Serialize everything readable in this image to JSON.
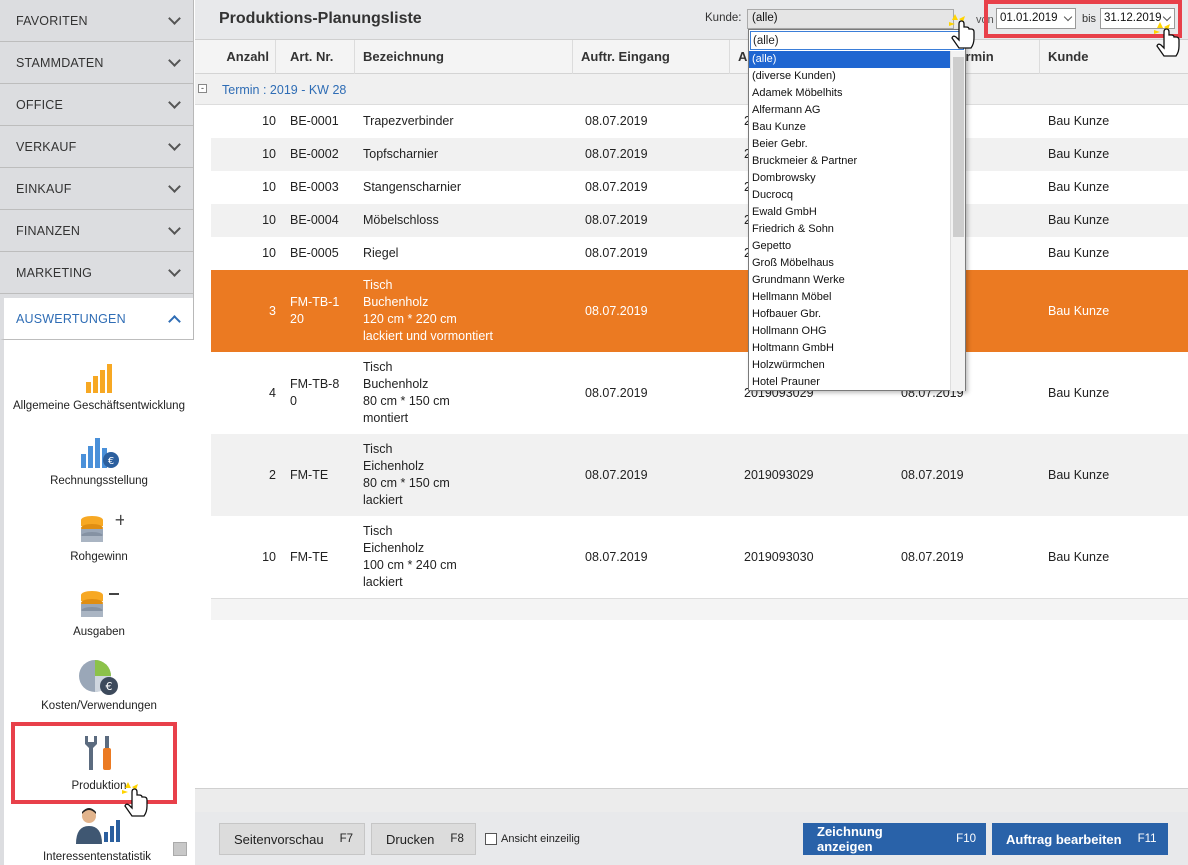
{
  "sidebar": {
    "nav": [
      {
        "label": "FAVORITEN"
      },
      {
        "label": "STAMMDATEN"
      },
      {
        "label": "OFFICE"
      },
      {
        "label": "VERKAUF"
      },
      {
        "label": "EINKAUF"
      },
      {
        "label": "FINANZEN"
      },
      {
        "label": "MARKETING"
      },
      {
        "label": "AUSWERTUNGEN"
      }
    ],
    "sub": [
      {
        "label": "Allgemeine Geschäftsentwicklung",
        "icon": "bar-chart-icon"
      },
      {
        "label": "Rechnungsstellung",
        "icon": "euro-bar-chart-icon"
      },
      {
        "label": "Rohgewinn",
        "icon": "coins-plus-icon"
      },
      {
        "label": "Ausgaben",
        "icon": "coins-minus-icon"
      },
      {
        "label": "Kosten/Verwendungen",
        "icon": "pie-euro-icon"
      },
      {
        "label": "Produktion",
        "icon": "tools-icon"
      },
      {
        "label": "Interessentenstatistik",
        "icon": "person-chart-icon"
      }
    ]
  },
  "header": {
    "title": "Produktions-Planungsliste",
    "kunde_label": "Kunde:",
    "kunde_value": "(alle)",
    "von_label": "von",
    "von_value": "01.01.2019",
    "bis_label": "bis",
    "bis_value": "31.12.2019"
  },
  "table": {
    "headers": [
      "Anzahl",
      "Art. Nr.",
      "Bezeichnung",
      "Auftr. Eingang",
      "A",
      "termin",
      "Kunde"
    ],
    "group": {
      "toggle": "-",
      "label": "Termin : 2019 - KW 28"
    },
    "rows": [
      {
        "anzahl": "10",
        "art": "BE-0001",
        "bez": "Trapezverbinder",
        "eingang": "08.07.2019",
        "auftrag": "2",
        "termin": "",
        "kunde": "Bau Kunze"
      },
      {
        "anzahl": "10",
        "art": "BE-0002",
        "bez": "Topfscharnier",
        "eingang": "08.07.2019",
        "auftrag": "2",
        "termin": "",
        "kunde": "Bau Kunze"
      },
      {
        "anzahl": "10",
        "art": "BE-0003",
        "bez": "Stangenscharnier",
        "eingang": "08.07.2019",
        "auftrag": "2",
        "termin": "",
        "kunde": "Bau Kunze"
      },
      {
        "anzahl": "10",
        "art": "BE-0004",
        "bez": "Möbelschloss",
        "eingang": "08.07.2019",
        "auftrag": "2",
        "termin": "",
        "kunde": "Bau Kunze"
      },
      {
        "anzahl": "10",
        "art": "BE-0005",
        "bez": "Riegel",
        "eingang": "08.07.2019",
        "auftrag": "2",
        "termin": "",
        "kunde": "Bau Kunze"
      },
      {
        "anzahl": "3",
        "art": "FM-TB-1\n20",
        "bez": "Tisch\nBuchenholz\n120 cm * 220 cm\nlackiert und vormontiert",
        "eingang": "08.07.2019",
        "auftrag": "",
        "termin": "",
        "kunde": "Bau Kunze"
      },
      {
        "anzahl": "4",
        "art": "FM-TB-8\n0",
        "bez": "Tisch\nBuchenholz\n80 cm * 150 cm\nmontiert",
        "eingang": "08.07.2019",
        "auftrag": "2019093029",
        "termin": "08.07.2019",
        "kunde": "Bau Kunze"
      },
      {
        "anzahl": "2",
        "art": "FM-TE",
        "bez": "Tisch\nEichenholz\n80 cm * 150 cm\nlackiert",
        "eingang": "08.07.2019",
        "auftrag": "2019093029",
        "termin": "08.07.2019",
        "kunde": "Bau Kunze"
      },
      {
        "anzahl": "10",
        "art": "FM-TE",
        "bez": "Tisch\nEichenholz\n100 cm * 240 cm\nlackiert",
        "eingang": "08.07.2019",
        "auftrag": "2019093030",
        "termin": "08.07.2019",
        "kunde": "Bau Kunze"
      }
    ]
  },
  "dropdown": {
    "selected": "(alle)",
    "options": [
      "(alle)",
      "(diverse Kunden)",
      "Adamek Möbelhits",
      "Alfermann AG",
      "Bau Kunze",
      "Beier Gebr.",
      "Bruckmeier & Partner",
      "Dombrowsky",
      "Ducrocq",
      "Ewald GmbH",
      "Friedrich & Sohn",
      "Gepetto",
      "Groß Möbelhaus",
      "Grundmann Werke",
      "Hellmann Möbel",
      "Hofbauer Gbr.",
      "Hollmann OHG",
      "Holtmann GmbH",
      "Holzwürmchen",
      "Hotel Prauner"
    ]
  },
  "footer": {
    "preview_label": "Seitenvorschau",
    "preview_key": "F7",
    "print_label": "Drucken",
    "print_key": "F8",
    "single_view_label": "Ansicht einzeilig",
    "drawing_label": "Zeichnung anzeigen",
    "drawing_key": "F10",
    "edit_label": "Auftrag bearbeiten",
    "edit_key": "F11"
  },
  "colors": {
    "selected_row": "#eb7a22",
    "accent_blue": "#2962a9",
    "highlight_red": "#e8404a",
    "link_blue": "#2f6db5"
  }
}
